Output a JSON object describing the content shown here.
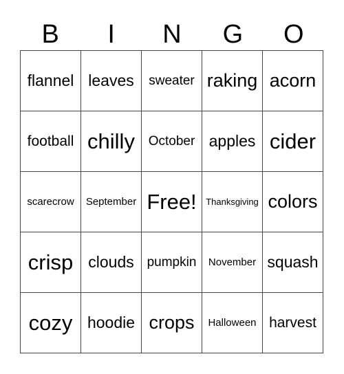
{
  "header": [
    "B",
    "I",
    "N",
    "G",
    "O"
  ],
  "board": [
    [
      "flannel",
      "leaves",
      "sweater",
      "raking",
      "acorn"
    ],
    [
      "football",
      "chilly",
      "October",
      "apples",
      "cider"
    ],
    [
      "scarecrow",
      "September",
      "Free!",
      "Thanksgiving",
      "colors"
    ],
    [
      "crisp",
      "clouds",
      "pumpkin",
      "November",
      "squash"
    ],
    [
      "cozy",
      "hoodie",
      "crops",
      "Halloween",
      "harvest"
    ]
  ]
}
